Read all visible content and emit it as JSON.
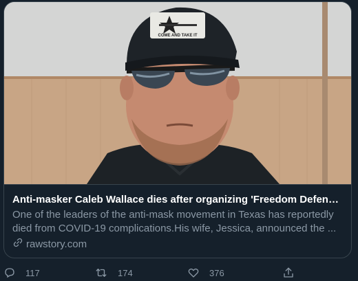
{
  "card": {
    "title": "Anti-masker Caleb Wallace dies after organizing 'Freedom Defenders' ...",
    "description_line1": "One of the leaders of the anti-mask movement in Texas has reportedly",
    "description_line2": "died from COVID-19 complications.His wife, Jessica, announced the ...",
    "domain": "rawstory.com",
    "hat_text": "COME AND TAKE IT"
  },
  "actions": {
    "reply_count": "117",
    "retweet_count": "174",
    "like_count": "376"
  },
  "icons": {
    "reply": "reply-icon",
    "retweet": "retweet-icon",
    "like": "like-icon",
    "share": "share-icon",
    "link": "link-icon"
  },
  "colors": {
    "background": "#15202b",
    "border": "#38444d",
    "title": "#ffffff",
    "secondary_text": "#8b98a5"
  }
}
